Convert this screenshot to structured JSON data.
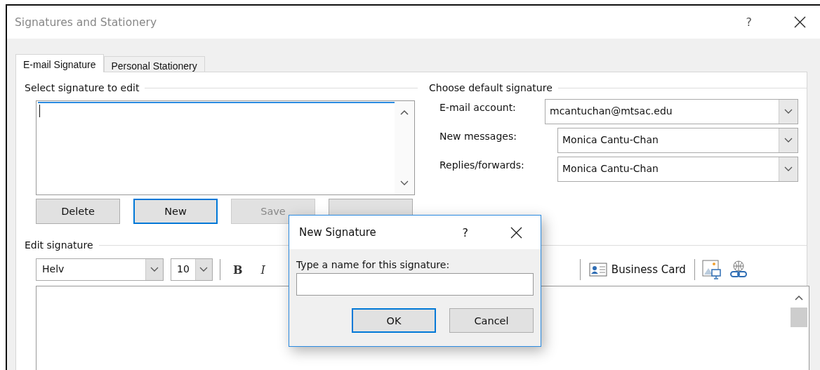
{
  "window": {
    "title": "Signatures and Stationery",
    "help": "?"
  },
  "tabs": [
    {
      "label": "E-mail Signature",
      "selected": true
    },
    {
      "label": "Personal Stationery",
      "selected": false
    }
  ],
  "select_group": {
    "title": "Select signature to edit",
    "buttons": [
      {
        "label": "Delete",
        "focused": false,
        "disabled": false
      },
      {
        "label": "New",
        "focused": true,
        "disabled": false
      },
      {
        "label": "Save",
        "focused": false,
        "disabled": true
      }
    ]
  },
  "default_group": {
    "title": "Choose default signature",
    "rows": [
      {
        "label": "E-mail account:",
        "value": "mcantuchan@mtsac.edu"
      },
      {
        "label": "New messages:",
        "value": "Monica Cantu-Chan"
      },
      {
        "label": "Replies/forwards:",
        "value": "Monica Cantu-Chan"
      }
    ]
  },
  "edit_group": {
    "title": "Edit signature",
    "font": "Helv",
    "size": "10",
    "format_buttons": [
      {
        "label": "B",
        "kind": "bold"
      },
      {
        "label": "I",
        "kind": "italic"
      }
    ],
    "business_card": "Business Card"
  },
  "modal": {
    "title": "New Signature",
    "help": "?",
    "prompt": "Type a name for this signature:",
    "buttons": [
      {
        "label": "OK",
        "default": true
      },
      {
        "label": "Cancel",
        "default": false
      }
    ]
  }
}
